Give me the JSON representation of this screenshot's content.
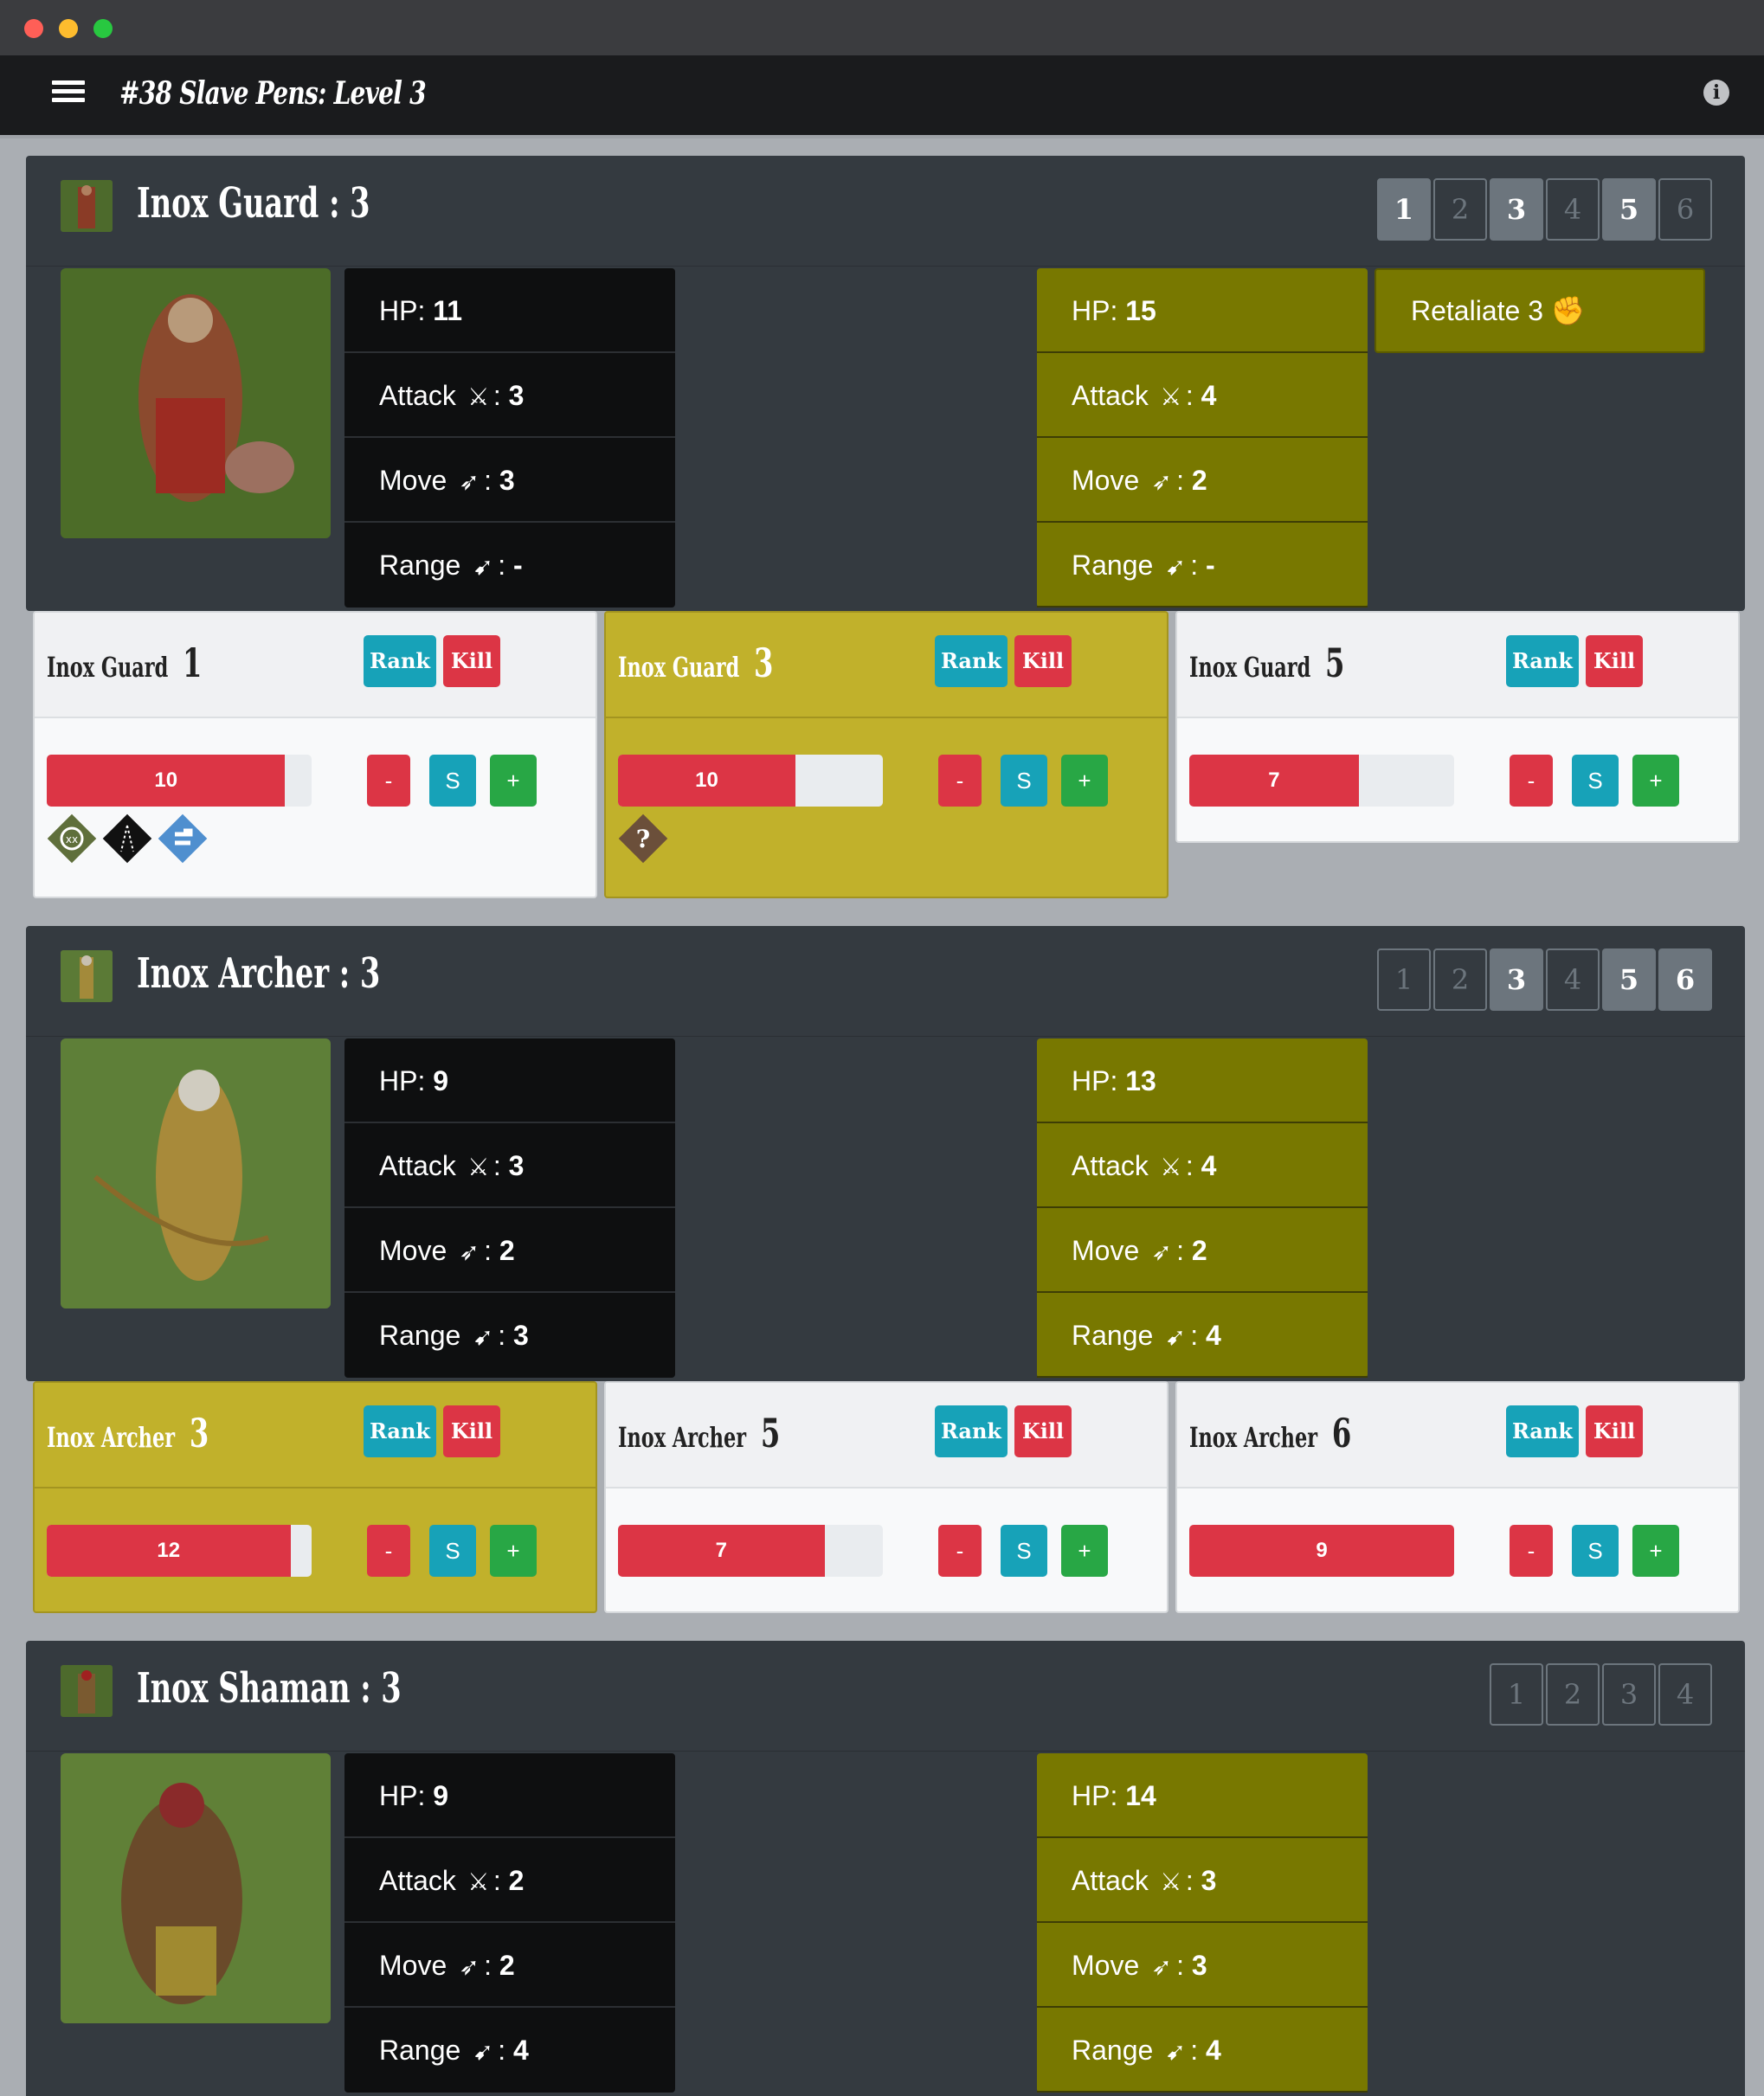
{
  "window": {
    "close_color": "#ff5f57",
    "min_color": "#febc2e",
    "max_color": "#28c840"
  },
  "navbar": {
    "title": "#38 Slave Pens: Level 3",
    "menu_icon": "hamburger-icon",
    "info_icon": "info-icon",
    "info_glyph": "i"
  },
  "labels": {
    "hp": "HP: ",
    "attack": "Attack ",
    "move": "Move ",
    "range": "Range ",
    "sep": ": ",
    "rank": "Rank",
    "kill": "Kill",
    "minus": "-",
    "shield": "S",
    "plus": "+"
  },
  "monsters": [
    {
      "title": "Inox Guard : 3",
      "pager": [
        "1",
        "2",
        "3",
        "4",
        "5",
        "6"
      ],
      "normal": {
        "hp": "11",
        "attack": "3",
        "move": "3",
        "range": "-"
      },
      "elite": {
        "hp": "15",
        "attack": "4",
        "move": "2",
        "range": "-"
      },
      "elite_extra": "Retaliate 3",
      "cards": [
        {
          "name": "Inox Guard",
          "number": "1",
          "elite": false,
          "hp": 10,
          "hp_fraction": 0.9,
          "conditions": [
            "muddle",
            "immobilize",
            "wound"
          ]
        },
        {
          "name": "Inox Guard",
          "number": "3",
          "elite": true,
          "hp": 10,
          "hp_fraction": 0.67,
          "conditions": [
            "unknown"
          ]
        },
        {
          "name": "Inox Guard",
          "number": "5",
          "elite": false,
          "hp": 7,
          "hp_fraction": 0.64,
          "conditions": []
        }
      ]
    },
    {
      "title": "Inox Archer : 3",
      "pager": [
        "1",
        "2",
        "3",
        "4",
        "5",
        "6"
      ],
      "normal": {
        "hp": "9",
        "attack": "3",
        "move": "2",
        "range": "3"
      },
      "elite": {
        "hp": "13",
        "attack": "4",
        "move": "2",
        "range": "4"
      },
      "cards": [
        {
          "name": "Inox Archer",
          "number": "3",
          "elite": true,
          "hp": 12,
          "hp_fraction": 0.92,
          "conditions": []
        },
        {
          "name": "Inox Archer",
          "number": "5",
          "elite": false,
          "hp": 7,
          "hp_fraction": 0.78,
          "conditions": []
        },
        {
          "name": "Inox Archer",
          "number": "6",
          "elite": false,
          "hp": 9,
          "hp_fraction": 1.0,
          "conditions": []
        }
      ]
    },
    {
      "title": "Inox Shaman : 3",
      "pager": [
        "1",
        "2",
        "3",
        "4"
      ],
      "normal": {
        "hp": "9",
        "attack": "2",
        "move": "2",
        "range": "4"
      },
      "elite": {
        "hp": "14",
        "attack": "3",
        "move": "3",
        "range": "4"
      }
    }
  ]
}
